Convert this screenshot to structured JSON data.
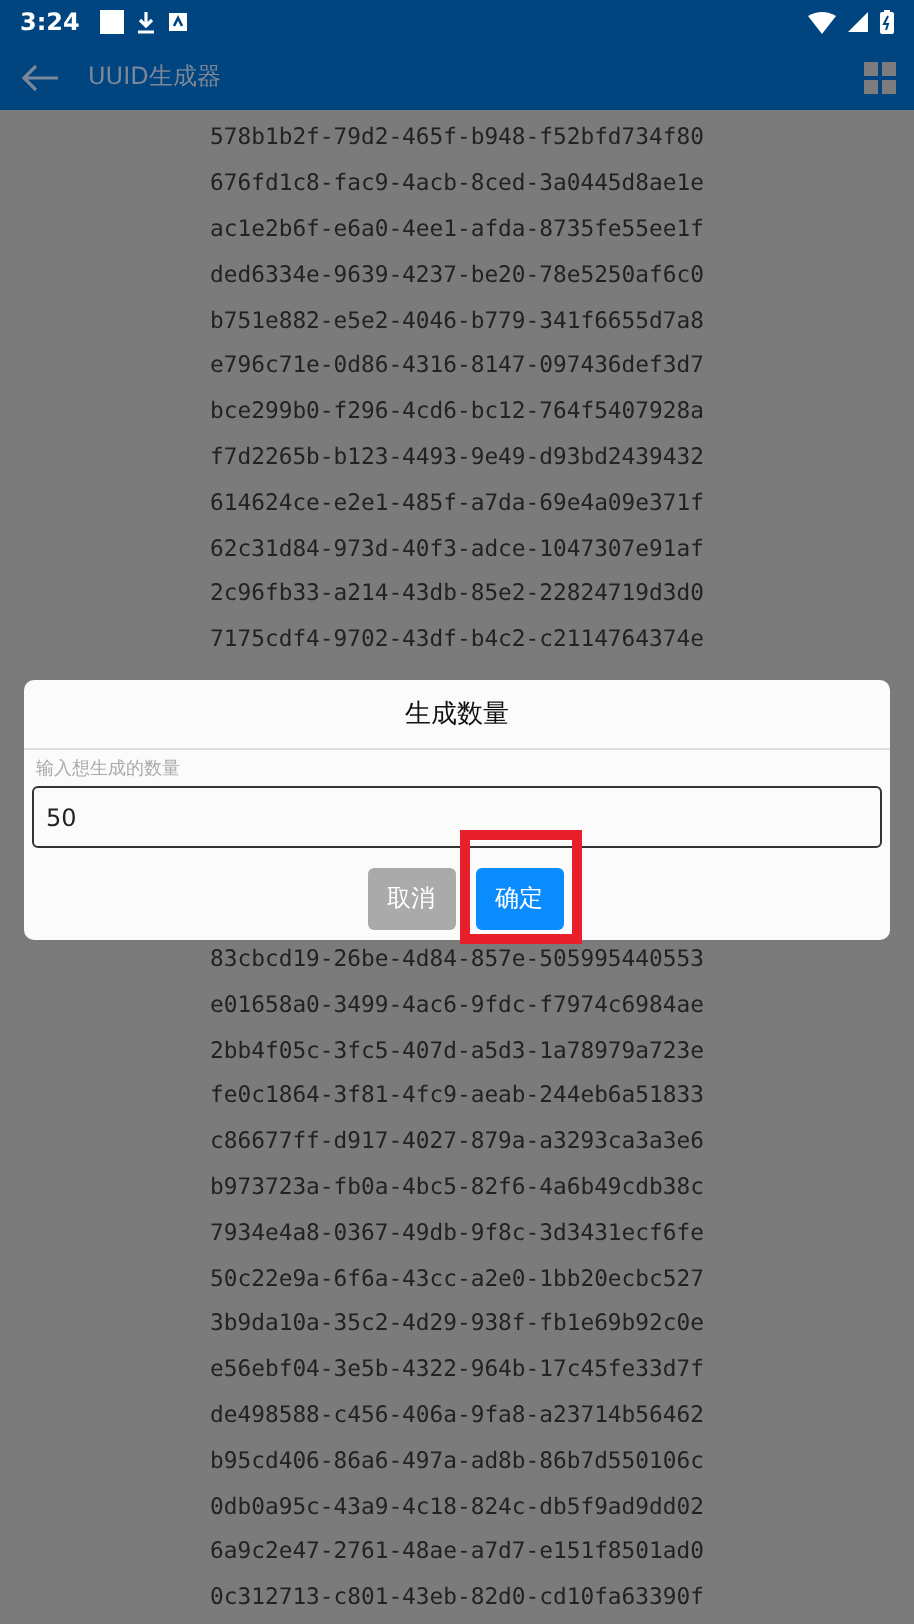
{
  "status_bar": {
    "time": "3:24"
  },
  "app_bar": {
    "title": "UUID生成器"
  },
  "uuids_above": [
    "578b1b2f-79d2-465f-b948-f52bfd734f80",
    "676fd1c8-fac9-4acb-8ced-3a0445d8ae1e",
    "ac1e2b6f-e6a0-4ee1-afda-8735fe55ee1f",
    "ded6334e-9639-4237-be20-78e5250af6c0",
    "b751e882-e5e2-4046-b779-341f6655d7a8",
    "e796c71e-0d86-4316-8147-097436def3d7",
    "bce299b0-f296-4cd6-bc12-764f5407928a",
    "f7d2265b-b123-4493-9e49-d93bd2439432",
    "614624ce-e2e1-485f-a7da-69e4a09e371f",
    "62c31d84-973d-40f3-adce-1047307e91af",
    "2c96fb33-a214-43db-85e2-22824719d3d0",
    "7175cdf4-9702-43df-b4c2-c2114764374e"
  ],
  "uuids_below": [
    "83cbcd19-26be-4d84-857e-505995440553",
    "e01658a0-3499-4ac6-9fdc-f7974c6984ae",
    "2bb4f05c-3fc5-407d-a5d3-1a78979a723e",
    "fe0c1864-3f81-4fc9-aeab-244eb6a51833",
    "c86677ff-d917-4027-879a-a3293ca3a3e6",
    "b973723a-fb0a-4bc5-82f6-4a6b49cdb38c",
    "7934e4a8-0367-49db-9f8c-3d3431ecf6fe",
    "50c22e9a-6f6a-43cc-a2e0-1bb20ecbc527",
    "3b9da10a-35c2-4d29-938f-fb1e69b92c0e",
    "e56ebf04-3e5b-4322-964b-17c45fe33d7f",
    "de498588-c456-406a-9fa8-a23714b56462",
    "b95cd406-86a6-497a-ad8b-86b7d550106c",
    "0db0a95c-43a9-4c18-824c-db5f9ad9dd02",
    "6a9c2e47-2761-48ae-a7d7-e151f8501ad0",
    "0c312713-c801-43eb-82d0-cd10fa63390f"
  ],
  "dialog": {
    "title": "生成数量",
    "field_label": "输入想生成的数量",
    "value": "50",
    "buttons": [
      {
        "label": "取消",
        "kind": "cancel"
      },
      {
        "label": "确定",
        "kind": "confirm"
      }
    ],
    "highlight": true
  }
}
